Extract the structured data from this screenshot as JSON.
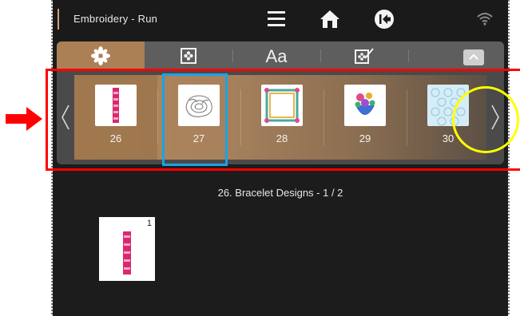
{
  "header": {
    "title": "Embroidery - Run",
    "icons": [
      "menu-icon",
      "home-icon",
      "back-icon",
      "wifi-icon"
    ]
  },
  "tabs": [
    {
      "name": "designs",
      "icon": "flower-icon",
      "active": true
    },
    {
      "name": "design-collection",
      "icon": "flower-frame-icon",
      "active": false
    },
    {
      "name": "fonts",
      "label": "Aa",
      "active": false
    },
    {
      "name": "my-designs",
      "icon": "design-edit-icon",
      "active": false
    }
  ],
  "carousel": {
    "items": [
      {
        "number": "26",
        "design": "bracelet",
        "selected": true
      },
      {
        "number": "27",
        "design": "rose-outline",
        "selected": false
      },
      {
        "number": "28",
        "design": "frame",
        "selected": false
      },
      {
        "number": "29",
        "design": "flower-bouquet",
        "selected": false
      },
      {
        "number": "30",
        "design": "lace-pattern",
        "selected": false
      }
    ]
  },
  "caption": "26. Bracelet Designs - 1 / 2",
  "patterns": [
    {
      "index": "1",
      "design": "bracelet"
    }
  ],
  "colors": {
    "accent": "#ab8055",
    "screen_bg": "#1c1c1c",
    "annotation_red": "#ff0000",
    "annotation_blue": "#1aa3e8",
    "annotation_yellow": "#ffff00"
  }
}
